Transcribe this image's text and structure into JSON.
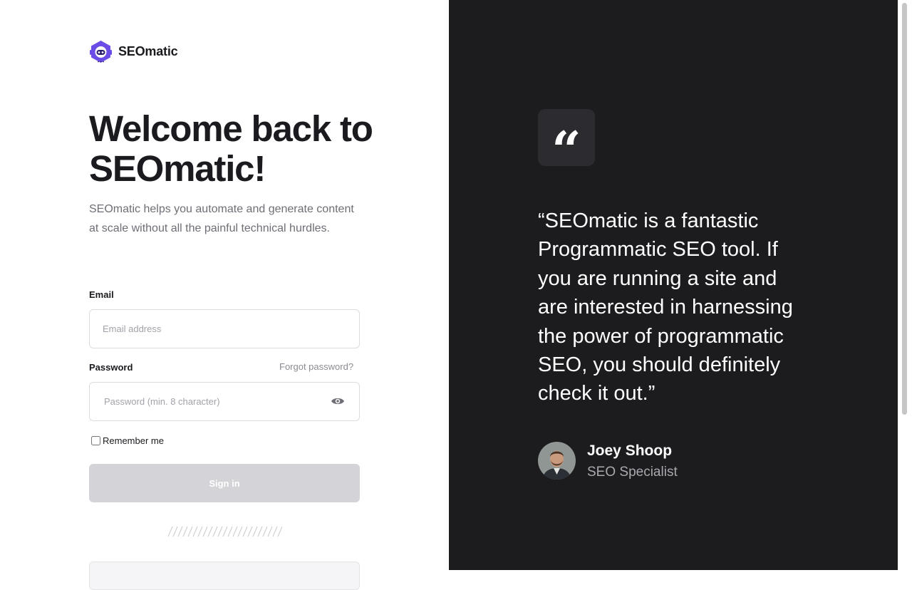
{
  "brand": {
    "name": "SEOmatic",
    "logo_icon": "robot-hexagon-icon",
    "accent": "#6c4ce6"
  },
  "login": {
    "title": "Welcome back to SEOmatic!",
    "subtitle": "SEOmatic helps you automate and generate content at scale without all the painful technical hurdles.",
    "email": {
      "label": "Email",
      "placeholder": "Email address",
      "value": ""
    },
    "password": {
      "label": "Password",
      "placeholder": "Password (min. 8 character)",
      "value": "",
      "forgot_label": "Forgot password?",
      "toggle_icon": "eye-icon"
    },
    "remember_label": "Remember me",
    "remember_checked": false,
    "signin_label": "Sign in",
    "signin_color": "#d4d4d8"
  },
  "testimonial": {
    "badge_icon": "quote-icon",
    "badge_glyph": "“",
    "quote": "“SEOmatic is a fantastic Programmatic SEO tool. If you are running a site and are interested in harnessing the power of programmatic SEO, you should definitely check it out.”",
    "author": {
      "name": "Joey Shoop",
      "role": "SEO Specialist"
    },
    "background": "#1c1b1e"
  }
}
